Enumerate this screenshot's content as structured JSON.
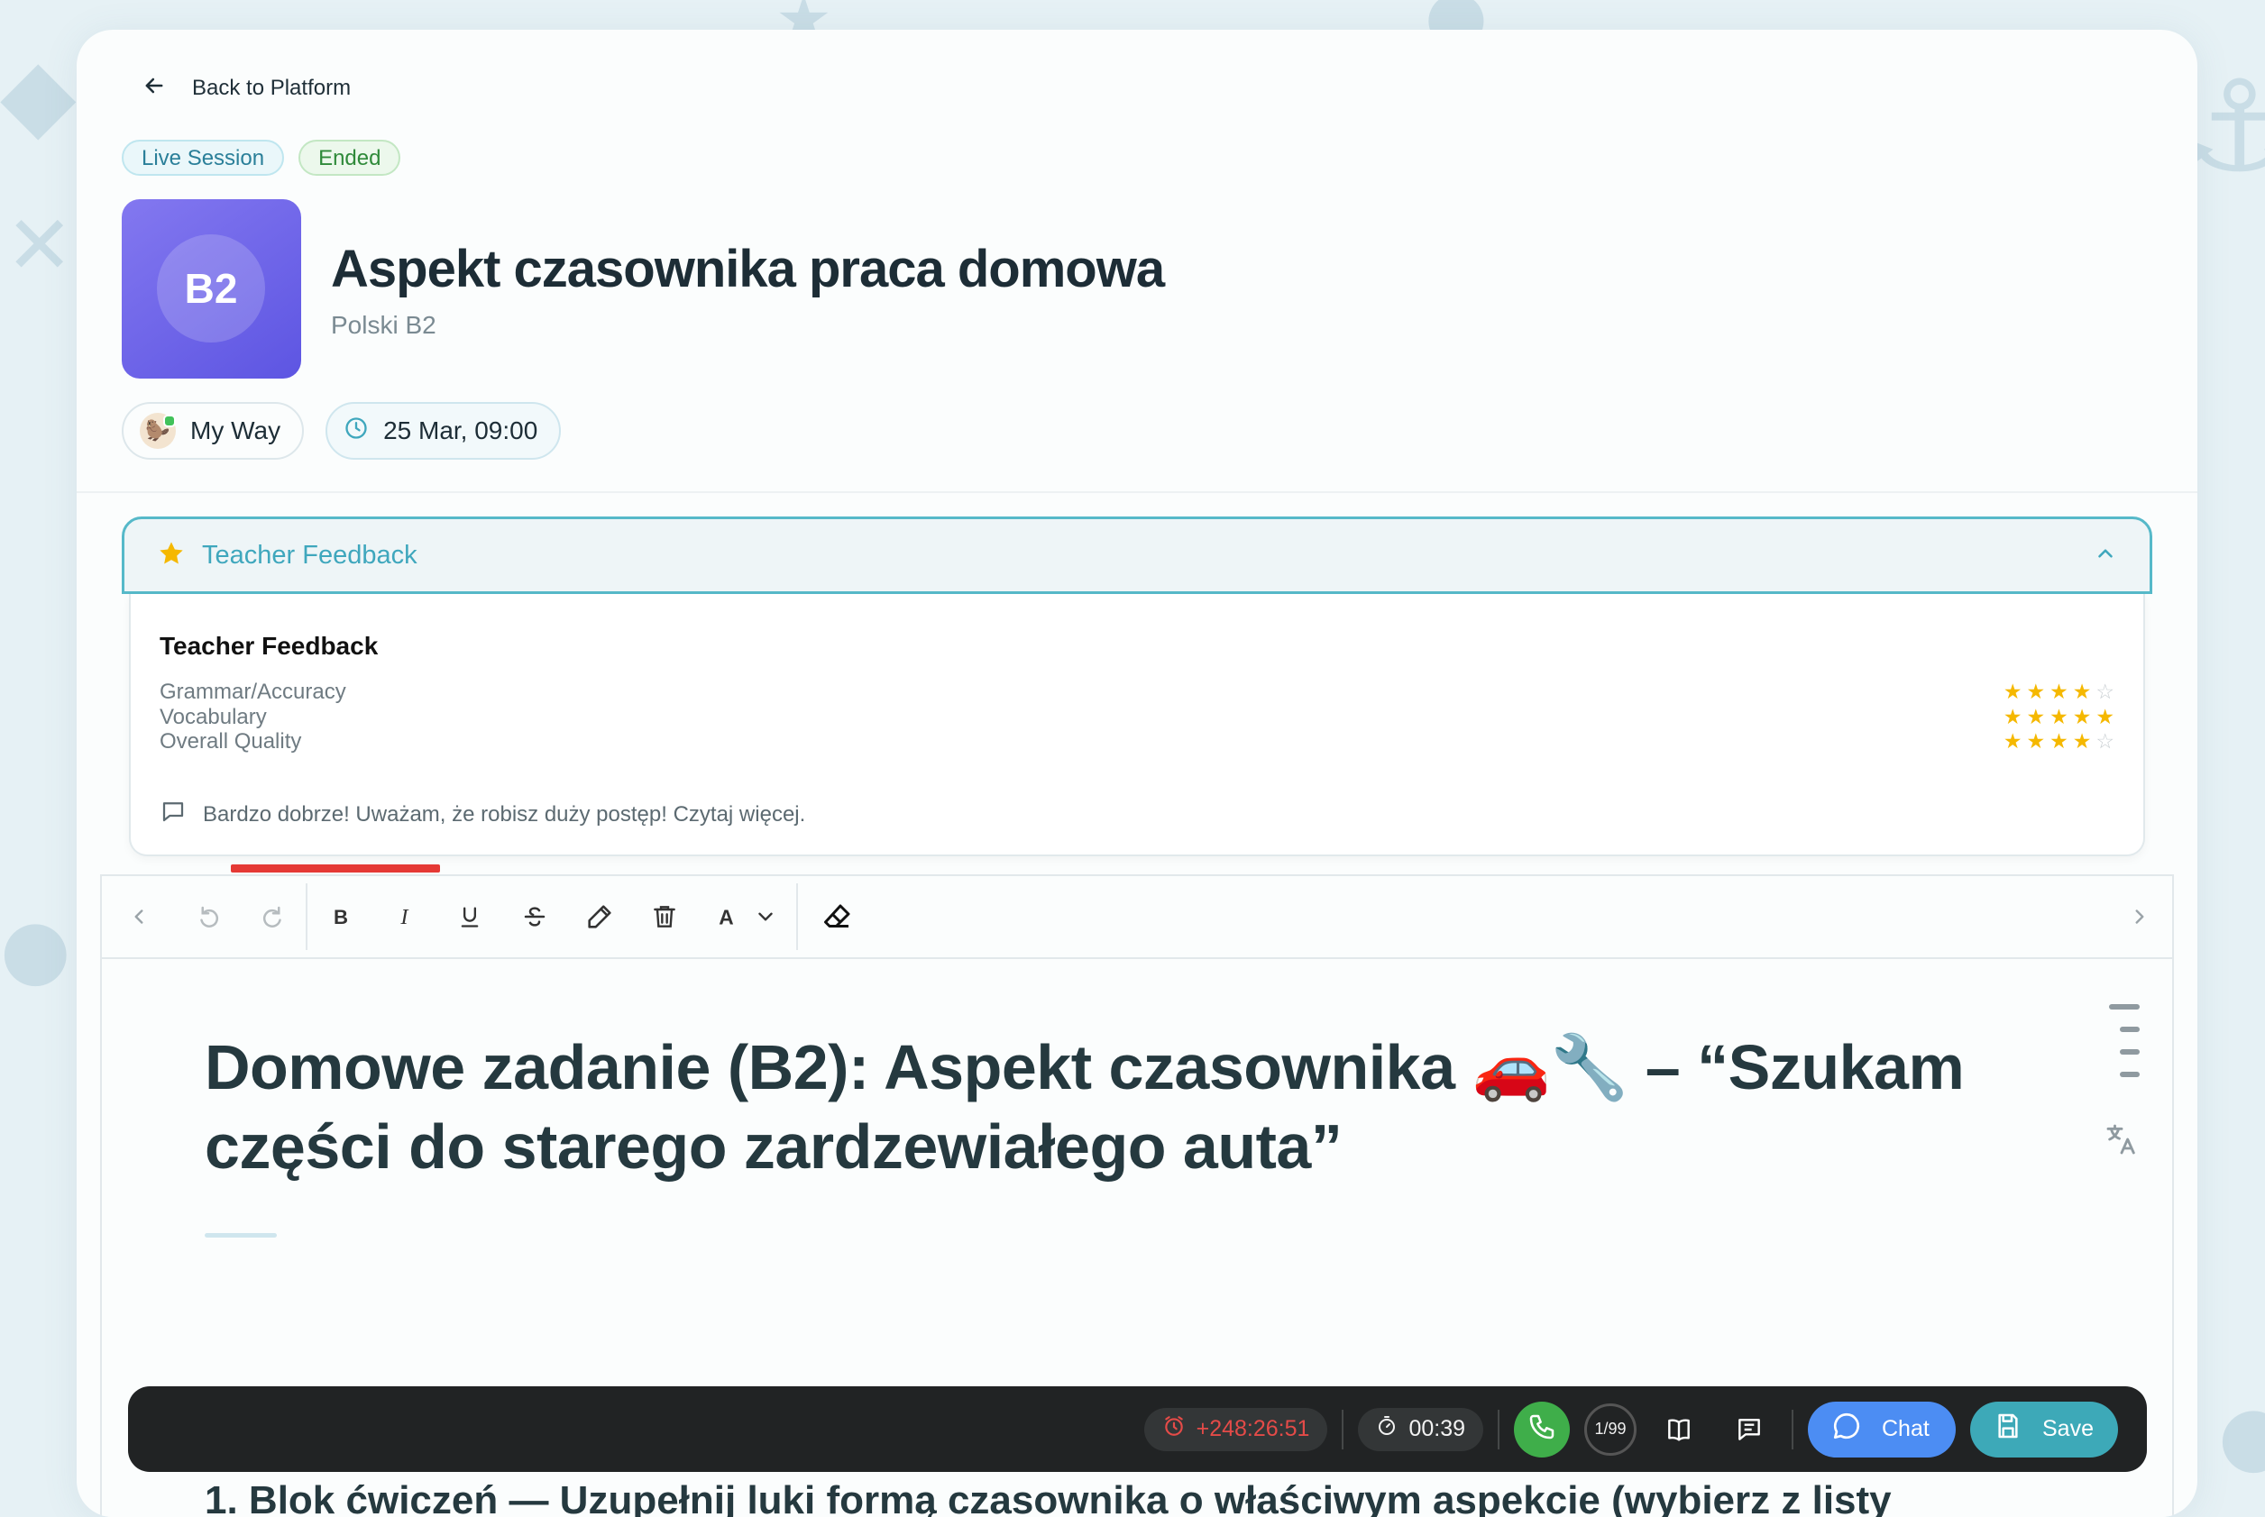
{
  "header": {
    "back_label": "Back to Platform",
    "badges": {
      "live": "Live Session",
      "status": "Ended"
    },
    "level_badge": "B2",
    "title": "Aspekt czasownika praca domowa",
    "course": "Polski B2",
    "teacher_name": "My Way",
    "datetime": "25 Mar, 09:00"
  },
  "feedback": {
    "section_label": "Teacher Feedback",
    "panel_title": "Teacher Feedback",
    "ratings": [
      {
        "label": "Grammar/Accuracy",
        "stars": 4,
        "max": 5
      },
      {
        "label": "Vocabulary",
        "stars": 5,
        "max": 5
      },
      {
        "label": "Overall Quality",
        "stars": 4,
        "max": 5
      }
    ],
    "comment": "Bardzo dobrze! Uważam, że robisz duży postęp! Czytaj więcej."
  },
  "editor": {
    "toolbar_icons": [
      "chevron-left-icon",
      "undo-icon",
      "redo-icon",
      "bold-icon",
      "italic-icon",
      "underline-icon",
      "strikethrough-icon",
      "highlighter-icon",
      "trash-icon",
      "font-color-icon",
      "chevron-down-icon",
      "eraser-icon",
      "chevron-right-icon"
    ],
    "heading": "Domowe zadanie (B2): Aspekt czasownika 🚗🔧 – “Szukam części do starego zardzewiałego auta”",
    "section_heading": "1. Blok ćwiczeń — Uzupełnij luki formą czasownika o właściwym aspekcie (wybierz z listy"
  },
  "callbar": {
    "overtime": "+248:26:51",
    "timer": "00:39",
    "counter": "1/99",
    "chat_label": "Chat",
    "save_label": "Save"
  },
  "colors": {
    "accent": "#3da9b8",
    "chat": "#4c8df3",
    "danger": "#e53935",
    "star": "#f5b800",
    "call_green": "#3fae4a"
  }
}
